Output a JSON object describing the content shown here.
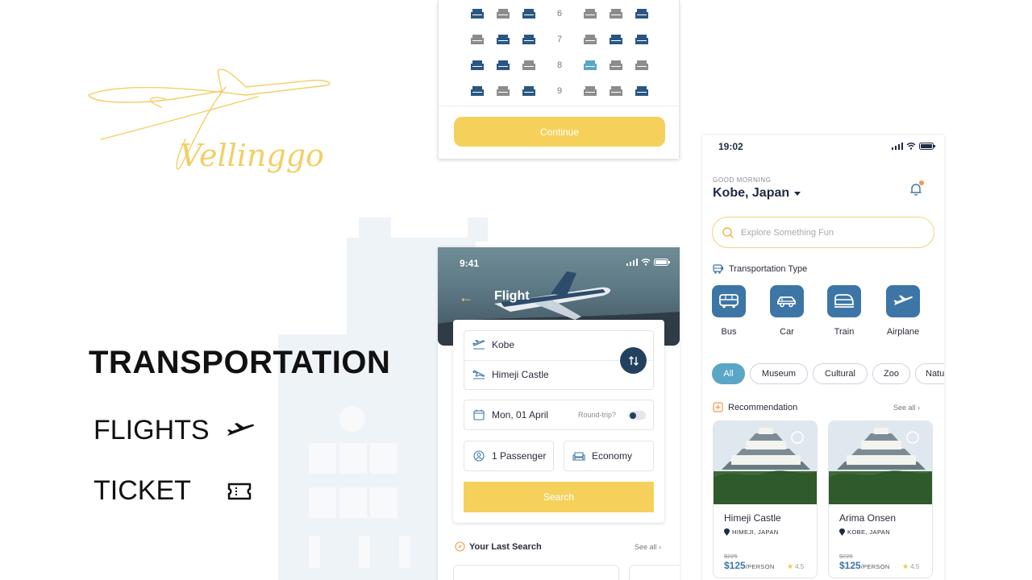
{
  "brand": {
    "name": "Vellinggo",
    "accent": "#f5d15c",
    "primary": "#23415f"
  },
  "left_panel": {
    "title": "TRANSPORTATION",
    "items": [
      {
        "label": "FLIGHTS",
        "icon": "airplane-icon"
      },
      {
        "label": "TICKET",
        "icon": "ticket-icon"
      }
    ]
  },
  "seat_screen": {
    "rows": [
      "6",
      "7",
      "8",
      "9"
    ],
    "continue_label": "Continue"
  },
  "flight_screen": {
    "status_time": "9:41",
    "title": "Flight",
    "from": "Kobe",
    "to": "Himeji Castle",
    "date": "Mon, 01 April",
    "round_trip_label": "Round-trip?",
    "passengers": "1 Passenger",
    "cabin_class": "Economy",
    "search_label": "Search",
    "last_search_title": "Your Last Search",
    "see_all": "See all"
  },
  "home_screen": {
    "status_time": "19:02",
    "greeting": "GOOD MORNING",
    "location": "Kobe, Japan",
    "search_placeholder": "Explore Something Fun",
    "transport_title": "Transportation Type",
    "transport_types": [
      {
        "label": "Bus",
        "icon": "bus-icon"
      },
      {
        "label": "Car",
        "icon": "car-icon"
      },
      {
        "label": "Train",
        "icon": "train-icon"
      },
      {
        "label": "Airplane",
        "icon": "airplane-icon"
      }
    ],
    "categories": [
      "All",
      "Museum",
      "Cultural",
      "Zoo",
      "Nature"
    ],
    "active_category": "All",
    "recommendation_title": "Recommendation",
    "see_all": "See all",
    "recommendations": [
      {
        "name": "Himeji Castle",
        "location": "HIMEJI, JAPAN",
        "old_price": "$225",
        "price": "$125",
        "unit": "/PERSON",
        "rating": "4.5"
      },
      {
        "name": "Arima Onsen",
        "location": "KOBE, JAPAN",
        "old_price": "$226",
        "price": "$125",
        "unit": "/PERSON",
        "rating": "4.5"
      }
    ]
  }
}
